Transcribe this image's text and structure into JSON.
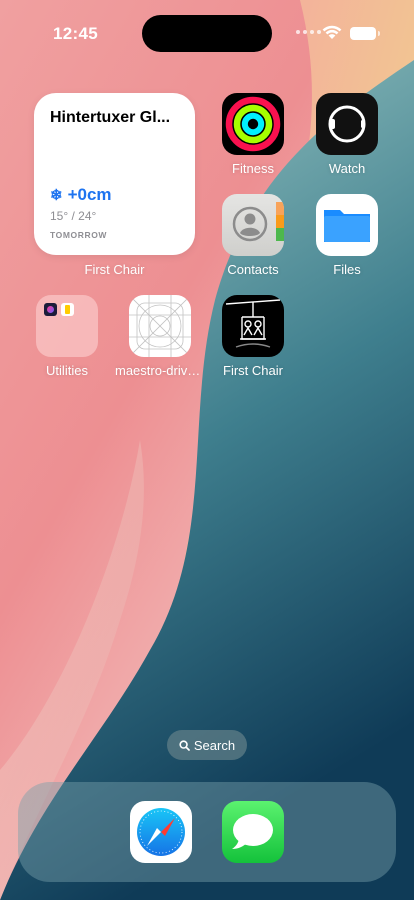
{
  "status_bar": {
    "time": "12:45"
  },
  "widget": {
    "location": "Hintertuxer Gl...",
    "snowfall": "+0cm",
    "temperature": "15° / 24°",
    "day": "TOMORROW",
    "app_label": "First Chair"
  },
  "apps": [
    {
      "label": "Fitness",
      "icon": "fitness-rings-icon"
    },
    {
      "label": "Watch",
      "icon": "watch-icon"
    },
    {
      "label": "Contacts",
      "icon": "contacts-icon"
    },
    {
      "label": "Files",
      "icon": "files-folder-icon"
    },
    {
      "label": "Utilities",
      "icon": "folder-icon"
    },
    {
      "label": "maestro-driver...",
      "icon": "app-grid-placeholder-icon"
    },
    {
      "label": "First Chair",
      "icon": "chairlift-icon"
    }
  ],
  "search": {
    "label": "Search"
  },
  "dock": {
    "apps": [
      {
        "name": "Safari",
        "icon": "safari-compass-icon"
      },
      {
        "name": "Messages",
        "icon": "messages-bubble-icon"
      }
    ]
  },
  "colors": {
    "snow_blue": "#1e74f0",
    "files_blue": "#1a8cff",
    "messages_green": "#2fd45a"
  }
}
